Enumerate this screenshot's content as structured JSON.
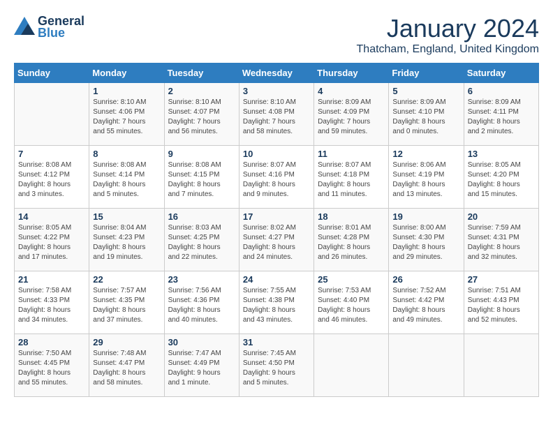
{
  "header": {
    "logo_line1": "General",
    "logo_line2": "Blue",
    "month": "January 2024",
    "location": "Thatcham, England, United Kingdom"
  },
  "weekdays": [
    "Sunday",
    "Monday",
    "Tuesday",
    "Wednesday",
    "Thursday",
    "Friday",
    "Saturday"
  ],
  "weeks": [
    [
      {
        "day": "",
        "info": ""
      },
      {
        "day": "1",
        "info": "Sunrise: 8:10 AM\nSunset: 4:06 PM\nDaylight: 7 hours\nand 55 minutes."
      },
      {
        "day": "2",
        "info": "Sunrise: 8:10 AM\nSunset: 4:07 PM\nDaylight: 7 hours\nand 56 minutes."
      },
      {
        "day": "3",
        "info": "Sunrise: 8:10 AM\nSunset: 4:08 PM\nDaylight: 7 hours\nand 58 minutes."
      },
      {
        "day": "4",
        "info": "Sunrise: 8:09 AM\nSunset: 4:09 PM\nDaylight: 7 hours\nand 59 minutes."
      },
      {
        "day": "5",
        "info": "Sunrise: 8:09 AM\nSunset: 4:10 PM\nDaylight: 8 hours\nand 0 minutes."
      },
      {
        "day": "6",
        "info": "Sunrise: 8:09 AM\nSunset: 4:11 PM\nDaylight: 8 hours\nand 2 minutes."
      }
    ],
    [
      {
        "day": "7",
        "info": "Sunrise: 8:08 AM\nSunset: 4:12 PM\nDaylight: 8 hours\nand 3 minutes."
      },
      {
        "day": "8",
        "info": "Sunrise: 8:08 AM\nSunset: 4:14 PM\nDaylight: 8 hours\nand 5 minutes."
      },
      {
        "day": "9",
        "info": "Sunrise: 8:08 AM\nSunset: 4:15 PM\nDaylight: 8 hours\nand 7 minutes."
      },
      {
        "day": "10",
        "info": "Sunrise: 8:07 AM\nSunset: 4:16 PM\nDaylight: 8 hours\nand 9 minutes."
      },
      {
        "day": "11",
        "info": "Sunrise: 8:07 AM\nSunset: 4:18 PM\nDaylight: 8 hours\nand 11 minutes."
      },
      {
        "day": "12",
        "info": "Sunrise: 8:06 AM\nSunset: 4:19 PM\nDaylight: 8 hours\nand 13 minutes."
      },
      {
        "day": "13",
        "info": "Sunrise: 8:05 AM\nSunset: 4:20 PM\nDaylight: 8 hours\nand 15 minutes."
      }
    ],
    [
      {
        "day": "14",
        "info": "Sunrise: 8:05 AM\nSunset: 4:22 PM\nDaylight: 8 hours\nand 17 minutes."
      },
      {
        "day": "15",
        "info": "Sunrise: 8:04 AM\nSunset: 4:23 PM\nDaylight: 8 hours\nand 19 minutes."
      },
      {
        "day": "16",
        "info": "Sunrise: 8:03 AM\nSunset: 4:25 PM\nDaylight: 8 hours\nand 22 minutes."
      },
      {
        "day": "17",
        "info": "Sunrise: 8:02 AM\nSunset: 4:27 PM\nDaylight: 8 hours\nand 24 minutes."
      },
      {
        "day": "18",
        "info": "Sunrise: 8:01 AM\nSunset: 4:28 PM\nDaylight: 8 hours\nand 26 minutes."
      },
      {
        "day": "19",
        "info": "Sunrise: 8:00 AM\nSunset: 4:30 PM\nDaylight: 8 hours\nand 29 minutes."
      },
      {
        "day": "20",
        "info": "Sunrise: 7:59 AM\nSunset: 4:31 PM\nDaylight: 8 hours\nand 32 minutes."
      }
    ],
    [
      {
        "day": "21",
        "info": "Sunrise: 7:58 AM\nSunset: 4:33 PM\nDaylight: 8 hours\nand 34 minutes."
      },
      {
        "day": "22",
        "info": "Sunrise: 7:57 AM\nSunset: 4:35 PM\nDaylight: 8 hours\nand 37 minutes."
      },
      {
        "day": "23",
        "info": "Sunrise: 7:56 AM\nSunset: 4:36 PM\nDaylight: 8 hours\nand 40 minutes."
      },
      {
        "day": "24",
        "info": "Sunrise: 7:55 AM\nSunset: 4:38 PM\nDaylight: 8 hours\nand 43 minutes."
      },
      {
        "day": "25",
        "info": "Sunrise: 7:53 AM\nSunset: 4:40 PM\nDaylight: 8 hours\nand 46 minutes."
      },
      {
        "day": "26",
        "info": "Sunrise: 7:52 AM\nSunset: 4:42 PM\nDaylight: 8 hours\nand 49 minutes."
      },
      {
        "day": "27",
        "info": "Sunrise: 7:51 AM\nSunset: 4:43 PM\nDaylight: 8 hours\nand 52 minutes."
      }
    ],
    [
      {
        "day": "28",
        "info": "Sunrise: 7:50 AM\nSunset: 4:45 PM\nDaylight: 8 hours\nand 55 minutes."
      },
      {
        "day": "29",
        "info": "Sunrise: 7:48 AM\nSunset: 4:47 PM\nDaylight: 8 hours\nand 58 minutes."
      },
      {
        "day": "30",
        "info": "Sunrise: 7:47 AM\nSunset: 4:49 PM\nDaylight: 9 hours\nand 1 minute."
      },
      {
        "day": "31",
        "info": "Sunrise: 7:45 AM\nSunset: 4:50 PM\nDaylight: 9 hours\nand 5 minutes."
      },
      {
        "day": "",
        "info": ""
      },
      {
        "day": "",
        "info": ""
      },
      {
        "day": "",
        "info": ""
      }
    ]
  ]
}
